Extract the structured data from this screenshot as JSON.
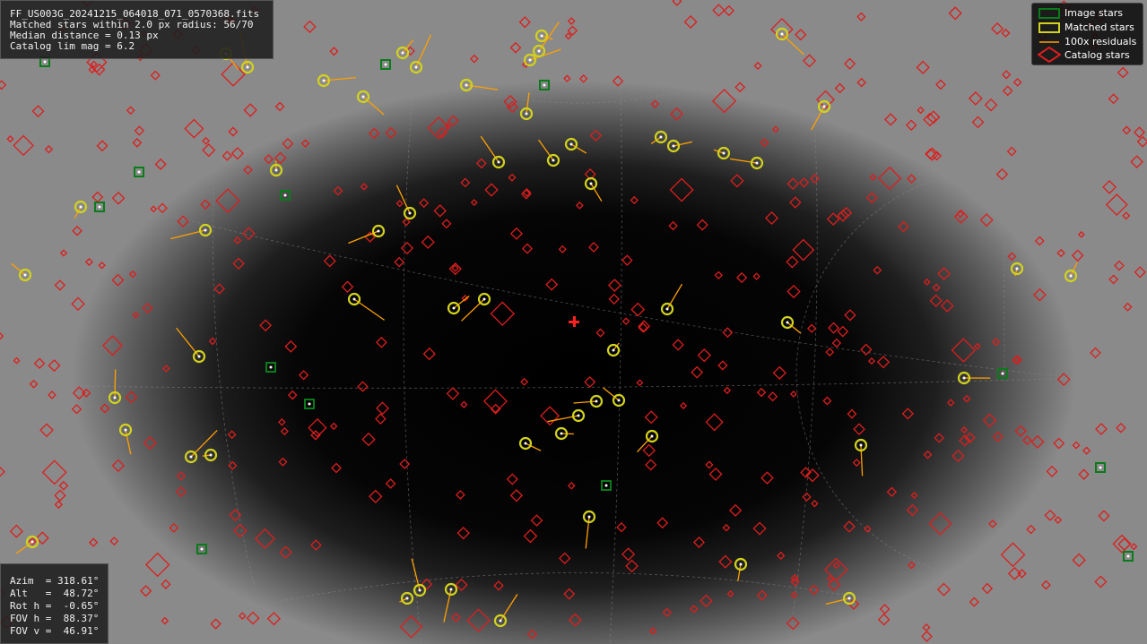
{
  "info": {
    "filename": "FF_US003G_20241215_064018_071_0570368.fits",
    "matched_line": "Matched stars within 2.0 px radius: 56/70",
    "median_line": "Median distance = 0.13 px",
    "catalog_line": "Catalog lim mag = 6.2"
  },
  "legend": {
    "image_stars": "Image stars",
    "matched_stars": "Matched stars",
    "residuals": "100x residuals",
    "catalog_stars": "Catalog stars"
  },
  "view": {
    "azim": "Azim  = 318.61°",
    "alt": "Alt   =  48.72°",
    "rot": "Rot h =  -0.65°",
    "fovh": "FOV h =  88.37°",
    "fovv": "FOV v =  46.91°"
  },
  "colors": {
    "image": "#0a7a1a",
    "matched": "#d2d21e",
    "residual": "#ffa000",
    "catalog": "#dc1e1e",
    "center": "#ff2020"
  }
}
